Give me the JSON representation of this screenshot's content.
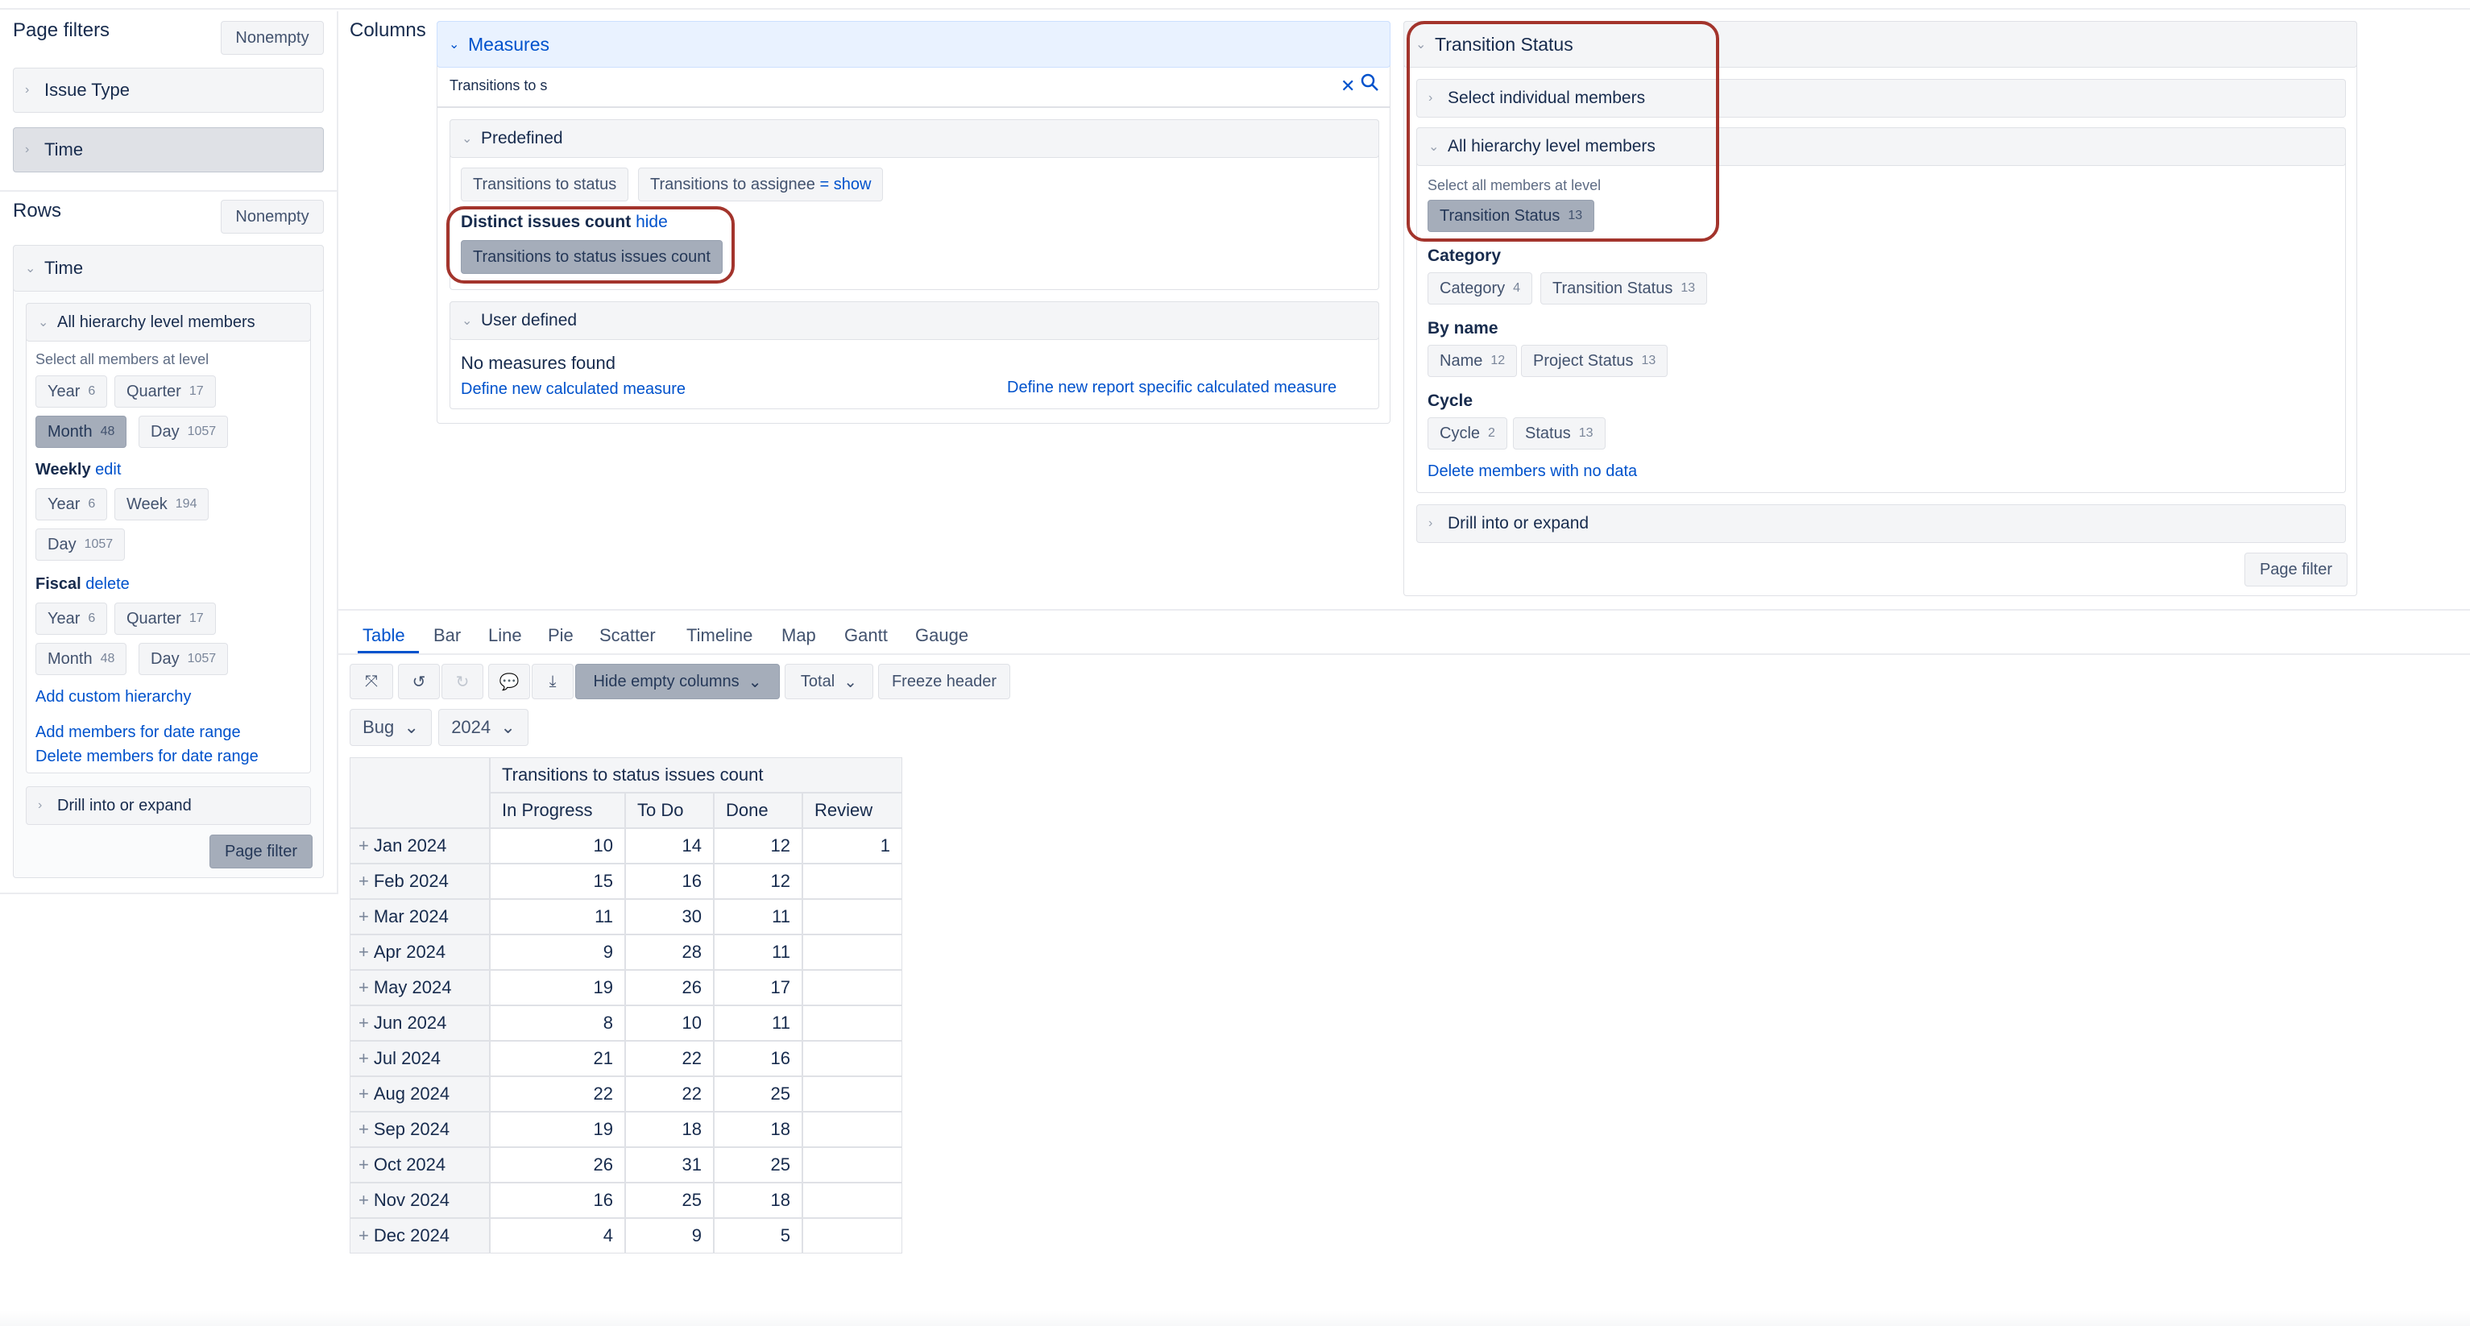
{
  "left": {
    "page_filters": {
      "title": "Page filters",
      "nonempty": "Nonempty",
      "items": [
        "Issue Type",
        "Time"
      ]
    },
    "rows": {
      "title": "Rows",
      "nonempty": "Nonempty",
      "dimension": "Time",
      "hierarchy_header": "All hierarchy level members",
      "select_all": "Select all members at level",
      "default_levels": [
        {
          "name": "Year",
          "count": "6"
        },
        {
          "name": "Quarter",
          "count": "17"
        },
        {
          "name": "Month",
          "count": "48"
        },
        {
          "name": "Day",
          "count": "1057"
        }
      ],
      "weekly": {
        "title": "Weekly",
        "action": "edit",
        "levels": [
          {
            "name": "Year",
            "count": "6"
          },
          {
            "name": "Week",
            "count": "194"
          },
          {
            "name": "Day",
            "count": "1057"
          }
        ]
      },
      "fiscal": {
        "title": "Fiscal",
        "action": "delete",
        "levels": [
          {
            "name": "Year",
            "count": "6"
          },
          {
            "name": "Quarter",
            "count": "17"
          },
          {
            "name": "Month",
            "count": "48"
          },
          {
            "name": "Day",
            "count": "1057"
          }
        ]
      },
      "add_custom_hierarchy": "Add custom hierarchy",
      "add_members_date_range": "Add members for date range",
      "delete_members_date_range": "Delete members for date range",
      "drill": "Drill into or expand",
      "page_filter": "Page filter"
    }
  },
  "columns": {
    "title": "Columns",
    "measures": {
      "header": "Measures",
      "search_value": "Transitions to s",
      "predefined_header": "Predefined",
      "chips": [
        "Transitions to status",
        "Transitions to assignee"
      ],
      "show": "show",
      "equals": "=",
      "distinct_label": "Distinct issues count",
      "hide": "hide",
      "distinct_chip": "Transitions to status issues count",
      "user_defined_header": "User defined",
      "no_measures": "No measures found",
      "define_calc": "Define new calculated measure",
      "define_report_calc": "Define new report specific calculated measure"
    },
    "transition_status": {
      "header": "Transition Status",
      "select_individual": "Select individual members",
      "all_hierarchy": "All hierarchy level members",
      "select_all": "Select all members at level",
      "default_chip": {
        "name": "Transition Status",
        "count": "13"
      },
      "groups": [
        {
          "title": "Category",
          "chips": [
            {
              "name": "Category",
              "count": "4"
            },
            {
              "name": "Transition Status",
              "count": "13"
            }
          ]
        },
        {
          "title": "By name",
          "chips": [
            {
              "name": "Name",
              "count": "12"
            },
            {
              "name": "Project Status",
              "count": "13"
            }
          ]
        },
        {
          "title": "Cycle",
          "chips": [
            {
              "name": "Cycle",
              "count": "2"
            },
            {
              "name": "Status",
              "count": "13"
            }
          ]
        }
      ],
      "delete_no_data": "Delete members with no data",
      "drill": "Drill into or expand",
      "page_filter": "Page filter"
    }
  },
  "view": {
    "tabs": [
      "Table",
      "Bar",
      "Line",
      "Pie",
      "Scatter",
      "Timeline",
      "Map",
      "Gantt",
      "Gauge"
    ],
    "active_tab": "Table",
    "toolbar": {
      "hide_empty": "Hide empty columns",
      "total": "Total",
      "freeze": "Freeze header"
    },
    "filters": {
      "issue_type": "Bug",
      "year": "2024"
    },
    "table": {
      "measure_header": "Transitions to status issues count",
      "columns": [
        "In Progress",
        "To Do",
        "Done",
        "Review"
      ],
      "rows": [
        {
          "label": "Jan 2024",
          "values": [
            "10",
            "14",
            "12",
            "1"
          ]
        },
        {
          "label": "Feb 2024",
          "values": [
            "15",
            "16",
            "12",
            ""
          ]
        },
        {
          "label": "Mar 2024",
          "values": [
            "11",
            "30",
            "11",
            ""
          ]
        },
        {
          "label": "Apr 2024",
          "values": [
            "9",
            "28",
            "11",
            ""
          ]
        },
        {
          "label": "May 2024",
          "values": [
            "19",
            "26",
            "17",
            ""
          ]
        },
        {
          "label": "Jun 2024",
          "values": [
            "8",
            "10",
            "11",
            ""
          ]
        },
        {
          "label": "Jul 2024",
          "values": [
            "21",
            "22",
            "16",
            ""
          ]
        },
        {
          "label": "Aug 2024",
          "values": [
            "22",
            "22",
            "25",
            ""
          ]
        },
        {
          "label": "Sep 2024",
          "values": [
            "19",
            "18",
            "18",
            ""
          ]
        },
        {
          "label": "Oct 2024",
          "values": [
            "26",
            "31",
            "25",
            ""
          ]
        },
        {
          "label": "Nov 2024",
          "values": [
            "16",
            "25",
            "18",
            ""
          ]
        },
        {
          "label": "Dec 2024",
          "values": [
            "4",
            "9",
            "5",
            ""
          ]
        }
      ]
    }
  },
  "colors": {
    "accent": "#0052cc",
    "highlight": "#a3342c",
    "selected_chip": "#a5adba"
  }
}
